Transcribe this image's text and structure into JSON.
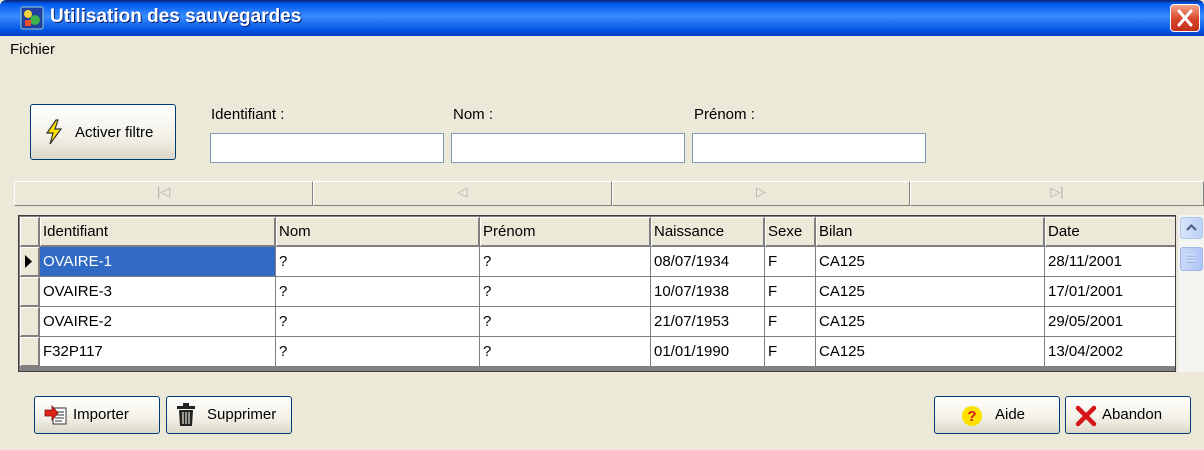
{
  "window": {
    "title": "Utilisation des sauvegardes"
  },
  "menu": {
    "items": [
      "Fichier"
    ]
  },
  "filter": {
    "button_label": "Activer filtre",
    "fields": [
      {
        "label": "Identifiant :",
        "value": ""
      },
      {
        "label": "Nom :",
        "value": ""
      },
      {
        "label": "Prénom :",
        "value": ""
      }
    ]
  },
  "navigator": {
    "buttons": [
      "first",
      "prior",
      "next",
      "last"
    ],
    "glyphs": [
      "|◁",
      "◁",
      "▷",
      "▷|"
    ]
  },
  "grid": {
    "columns": [
      "Identifiant",
      "Nom",
      "Prénom",
      "Naissance",
      "Sexe",
      "Bilan",
      "Date"
    ],
    "rows": [
      [
        "OVAIRE-1",
        "?",
        "?",
        "08/07/1934",
        "F",
        "CA125",
        "28/11/2001"
      ],
      [
        "OVAIRE-3",
        "?",
        "?",
        "10/07/1938",
        "F",
        "CA125",
        "17/01/2001"
      ],
      [
        "OVAIRE-2",
        "?",
        "?",
        "21/07/1953",
        "F",
        "CA125",
        "29/05/2001"
      ],
      [
        "F32P117",
        "?",
        "?",
        "01/01/1990",
        "F",
        "CA125",
        "13/04/2002"
      ]
    ],
    "selected_row": 0
  },
  "buttons": {
    "importer": "Importer",
    "supprimer": "Supprimer",
    "aide": "Aide",
    "abandon": "Abandon"
  },
  "colors": {
    "selection": "#316AC5",
    "titlebar": "#0058EE",
    "face": "#ECE9D8"
  }
}
